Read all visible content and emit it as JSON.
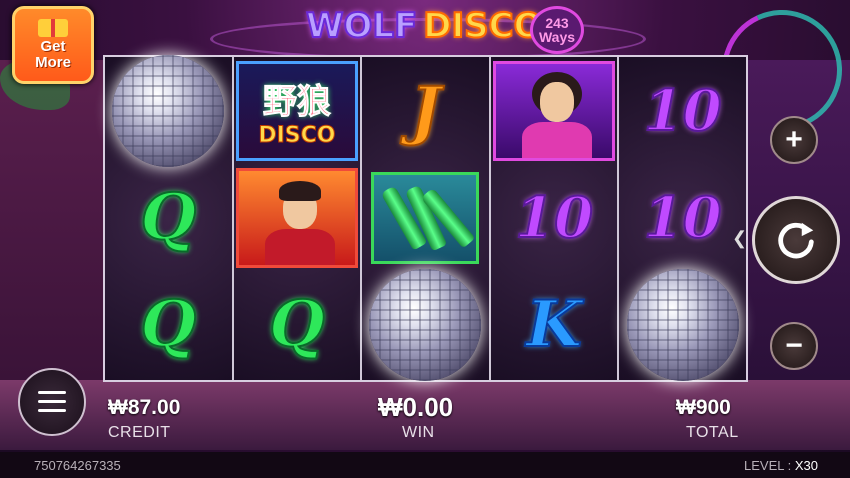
{
  "header": {
    "get_more_line1": "Get",
    "get_more_line2": "More",
    "logo_word1": "WOLF",
    "logo_word2": "DISCO",
    "ways_count": "243",
    "ways_label": "Ways"
  },
  "reels": [
    [
      "disco-ball",
      "Q",
      "Q"
    ],
    [
      "wild",
      "portrait-man",
      "Q"
    ],
    [
      "J",
      "bottles",
      "disco-ball"
    ],
    [
      "portrait-woman",
      "10",
      "K"
    ],
    [
      "10",
      "10",
      "disco-ball"
    ]
  ],
  "symbols": {
    "Q": "Q",
    "J": "J",
    "K": "K",
    "ten": "10",
    "wild_cn": "野狼",
    "wild_en": "DISCO"
  },
  "controls": {
    "plus": "+",
    "minus": "−"
  },
  "stats": {
    "credit_value": "₩87.00",
    "credit_label": "CREDIT",
    "win_value": "₩0.00",
    "win_label": "WIN",
    "total_value": "₩900",
    "total_label": "TOTAL"
  },
  "footer": {
    "session_id": "750764267335",
    "level_label": "LEVEL :",
    "level_value": "X30"
  },
  "colors": {
    "q": "#2ee85a",
    "j": "#ff9a1a",
    "k": "#2a9aff",
    "ten": "#c04aff"
  }
}
